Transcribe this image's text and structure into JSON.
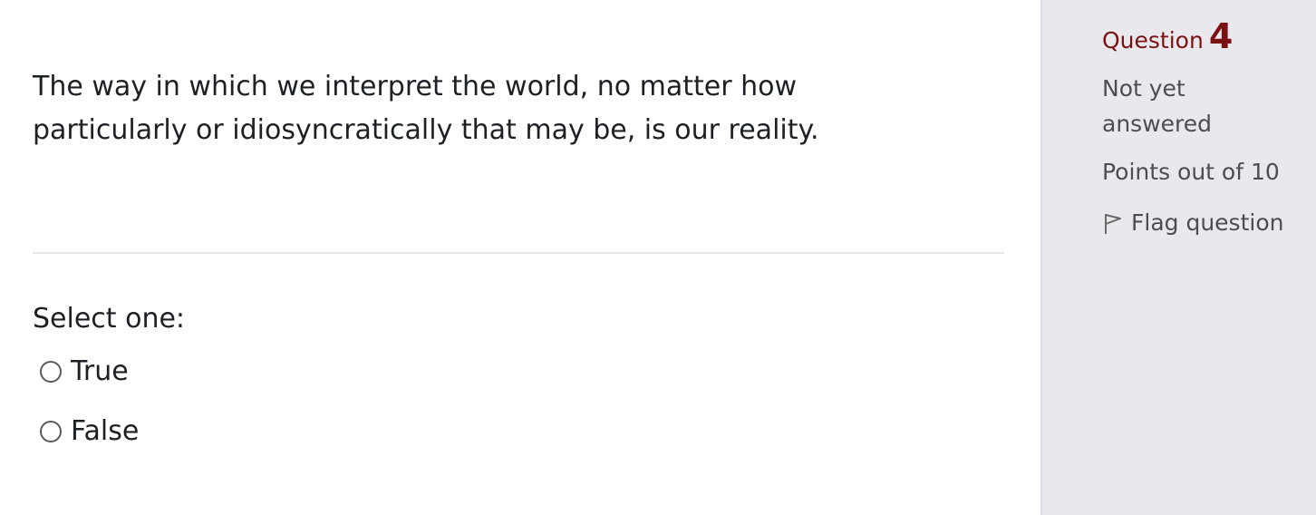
{
  "question": {
    "text": "The way in which we interpret the world, no matter how particularly or idiosyncratically that may be, is our reality.",
    "prompt": "Select one:",
    "options": [
      {
        "label": "True",
        "selected": false
      },
      {
        "label": "False",
        "selected": false
      }
    ]
  },
  "info": {
    "heading_label": "Question",
    "number": "4",
    "state": "Not yet answered",
    "points": "Points out of 10",
    "flag_label": "Flag question",
    "flag_icon": "flag-outline-icon"
  },
  "colors": {
    "heading": "#7a1212",
    "sidebar_bg": "#e9e9ed",
    "text": "#1d2125",
    "muted_text": "#4a4e52"
  }
}
